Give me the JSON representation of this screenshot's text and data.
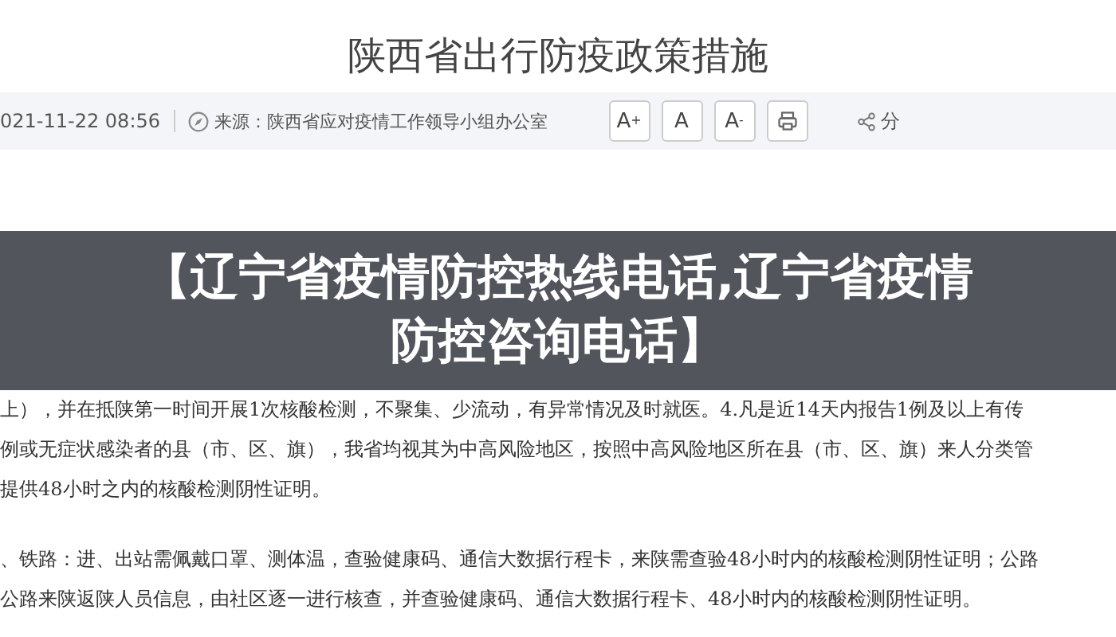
{
  "article": {
    "title": "陕西省出行防疫政策措施",
    "datetime": "021-11-22 08:56",
    "source": "来源：陕西省应对疫情工作领导小组办公室",
    "font_buttons": [
      {
        "kind": "text",
        "label": "A",
        "sup": "+"
      },
      {
        "kind": "text",
        "label": "A"
      },
      {
        "kind": "text",
        "label": "A",
        "sup": "-"
      },
      {
        "kind": "print"
      }
    ],
    "share": "分"
  },
  "banner": {
    "title": "【辽宁省疫情防控热线电话,辽宁省疫情防控咨询电话】"
  },
  "paragraphs": [
    [
      "上），并在抵陕第一时间开展1次核酸检测，不聚集、少流动，有异常情况及时就医。4.凡是近14天内报告1例及以上有传",
      "例或无症状感染者的县（市、区、旗），我省均视其为中高风险地区，按照中高风险地区所在县（市、区、旗）来人分类管",
      "提供48小时之内的核酸检测阴性证明。"
    ],
    [
      "、铁路：进、出站需佩戴口罩、测体温，查验健康码、通信大数据行程卡，来陕需查验48小时内的核酸检测阴性证明；公路",
      "公路来陕返陕人员信息，由社区逐一进行核查，并查验健康码、通信大数据行程卡、48小时内的核酸检测阴性证明。"
    ]
  ]
}
